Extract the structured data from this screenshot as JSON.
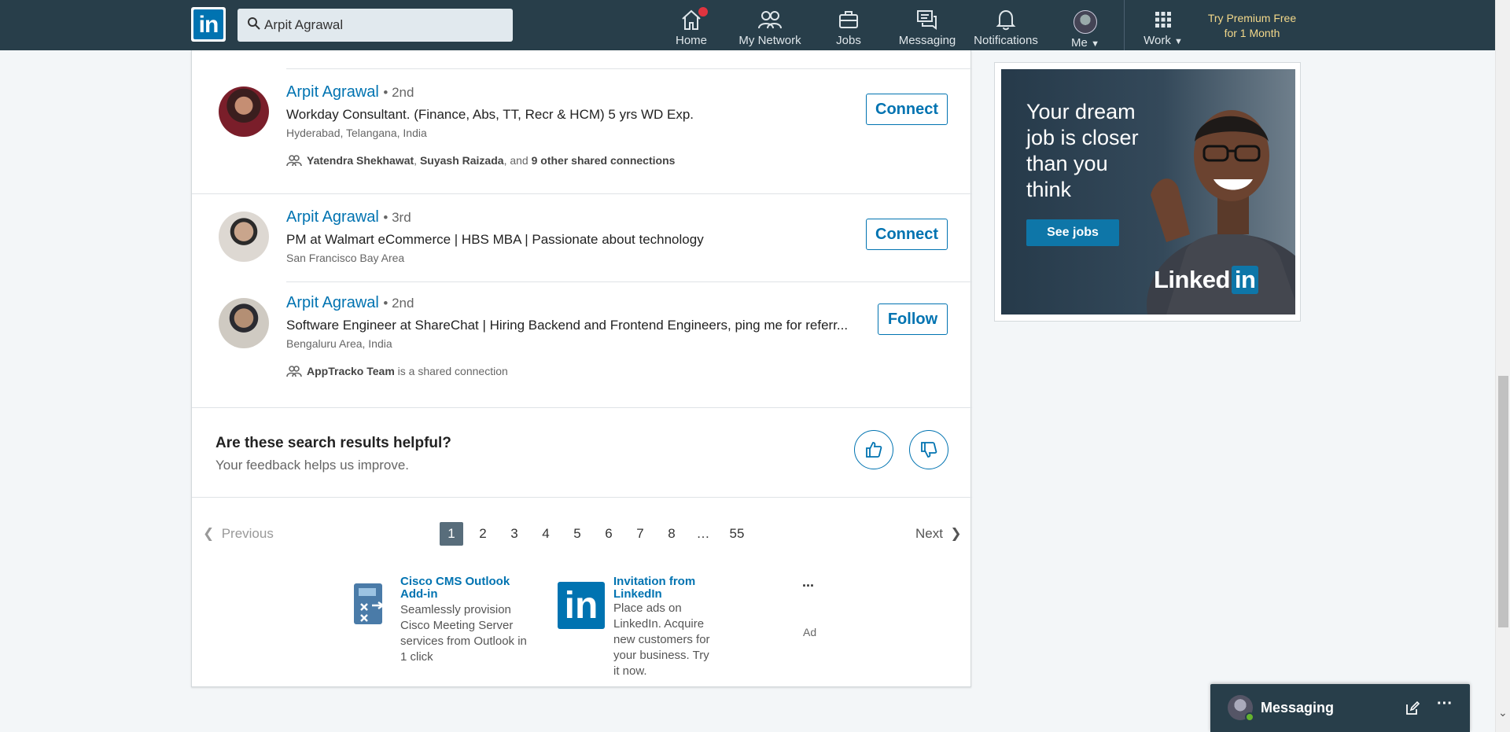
{
  "nav": {
    "search_value": "Arpit Agrawal",
    "home": "Home",
    "network": "My Network",
    "jobs": "Jobs",
    "messaging": "Messaging",
    "notifications": "Notifications",
    "me": "Me",
    "work": "Work",
    "premium_line1": "Try Premium Free",
    "premium_line2": "for 1 Month"
  },
  "results": [
    {
      "name": "Arpit Agrawal",
      "degree": "• 2nd",
      "headline": "Workday Consultant. (Finance, Abs, TT, Recr & HCM) 5 yrs WD Exp.",
      "location": "Hyderabad, Telangana, India",
      "shared_a": "Yatendra Shekhawat",
      "shared_sep": ", ",
      "shared_b": "Suyash Raizada",
      "shared_mid": ", and ",
      "shared_c": "9 other shared connections",
      "action": "Connect"
    },
    {
      "name": "Arpit Agrawal",
      "degree": "• 3rd",
      "headline": "PM at Walmart eCommerce | HBS MBA | Passionate about technology",
      "location": "San Francisco Bay Area",
      "action": "Connect"
    },
    {
      "name": "Arpit Agrawal",
      "degree": "• 2nd",
      "headline": "Software Engineer at ShareChat | Hiring Backend and Frontend Engineers, ping me for referr...",
      "location": "Bengaluru Area, India",
      "shared_a": "AppTracko Team",
      "shared_tail": " is a shared connection",
      "action": "Follow"
    }
  ],
  "feedback": {
    "question": "Are these search results helpful?",
    "sub": "Your feedback helps us improve."
  },
  "pagination": {
    "previous": "Previous",
    "next": "Next",
    "pages": [
      "1",
      "2",
      "3",
      "4",
      "5",
      "6",
      "7",
      "8",
      "…",
      "55"
    ],
    "current": "1"
  },
  "text_ads": [
    {
      "title": "Cisco CMS Outlook Add-in",
      "desc": "Seamlessly provision Cisco Meeting Server services from Outlook in 1 click"
    },
    {
      "title": "Invitation from LinkedIn",
      "desc": "Place ads on LinkedIn. Acquire new customers for your business. Try it now."
    }
  ],
  "ad_label": "Ad",
  "ad_more": "...",
  "right_ad": {
    "headline_1": "Your dream",
    "headline_2": "job is closer",
    "headline_3": "than you",
    "headline_4": "think",
    "cta": "See jobs",
    "brand_linked": "Linked",
    "brand_in": "in"
  },
  "messaging_bar": {
    "label": "Messaging"
  },
  "colors": {
    "nav_bg": "#283e4a",
    "brand_blue": "#0073b1",
    "premium_gold": "#f3d88a"
  }
}
